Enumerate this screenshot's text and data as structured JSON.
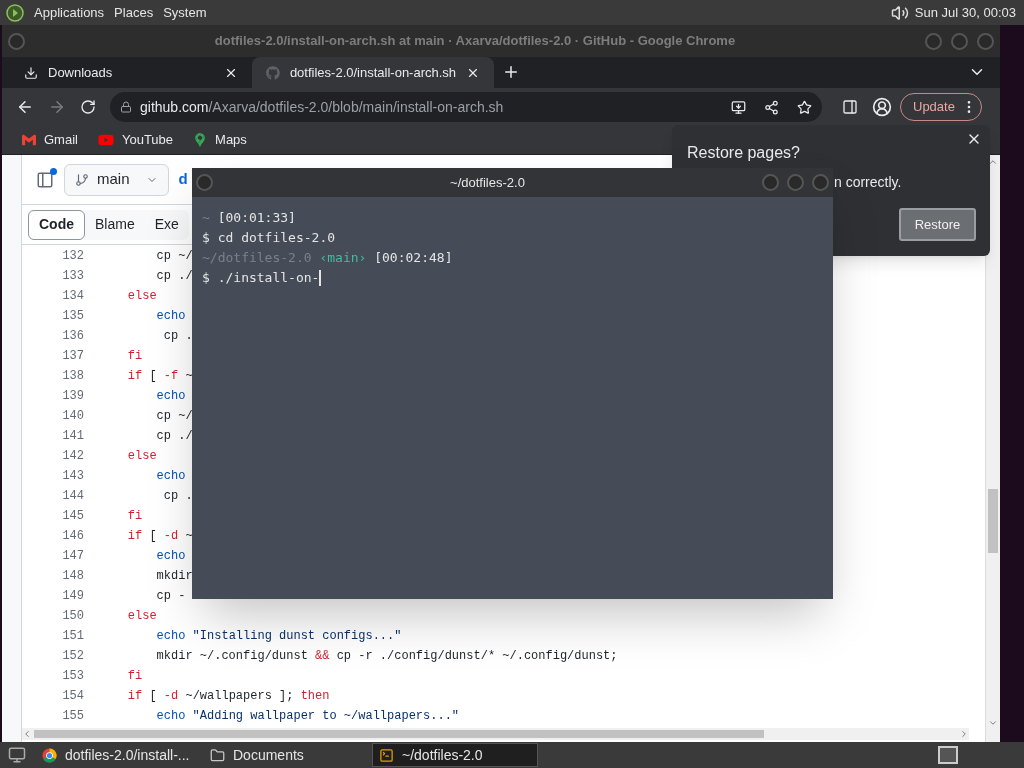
{
  "top_panel": {
    "menus": [
      "Applications",
      "Places",
      "System"
    ],
    "clock": "Sun Jul 30, 00:03"
  },
  "browser": {
    "title": "dotfiles-2.0/install-on-arch.sh at main · Axarva/dotfiles-2.0 · GitHub - Google Chrome",
    "tabs": [
      {
        "label": "Downloads",
        "kind": "download",
        "selected": false
      },
      {
        "label": "dotfiles-2.0/install-on-arch.sh",
        "kind": "github",
        "selected": true
      }
    ],
    "forward_disabled": true,
    "address": {
      "host": "github.com",
      "path": "/Axarva/dotfiles-2.0/blob/main/install-on-arch.sh"
    },
    "update_button": "Update",
    "bookmarks": [
      {
        "label": "Gmail",
        "kind": "gmail"
      },
      {
        "label": "YouTube",
        "kind": "youtube"
      },
      {
        "label": "Maps",
        "kind": "maps"
      }
    ]
  },
  "restore_popup": {
    "title": "Restore pages?",
    "message": "n correctly.",
    "button": "Restore"
  },
  "github": {
    "branch": "main",
    "repo_link": "d",
    "view_tabs": [
      {
        "label": "Code",
        "selected": true
      },
      {
        "label": "Blame",
        "selected": false
      },
      {
        "label": "Exe",
        "selected": false
      }
    ],
    "lines": [
      {
        "number": "132",
        "tokens": [
          {
            "kind": "plain",
            "text": "        cp ~/"
          }
        ]
      },
      {
        "number": "133",
        "tokens": [
          {
            "kind": "plain",
            "text": "        cp ./"
          }
        ]
      },
      {
        "number": "134",
        "tokens": [
          {
            "kind": "keyword",
            "text": "    else"
          }
        ]
      },
      {
        "number": "135",
        "tokens": [
          {
            "kind": "builtin",
            "text": "        echo"
          }
        ]
      },
      {
        "number": "136",
        "tokens": [
          {
            "kind": "plain",
            "text": "         cp ."
          }
        ]
      },
      {
        "number": "137",
        "tokens": [
          {
            "kind": "keyword",
            "text": "    fi"
          }
        ]
      },
      {
        "number": "138",
        "tokens": [
          {
            "kind": "keyword",
            "text": "    if"
          },
          {
            "kind": "plain",
            "text": " [ "
          },
          {
            "kind": "keyword",
            "text": "-f"
          },
          {
            "kind": "plain",
            "text": " ~"
          }
        ]
      },
      {
        "number": "139",
        "tokens": [
          {
            "kind": "builtin",
            "text": "        echo"
          }
        ]
      },
      {
        "number": "140",
        "tokens": [
          {
            "kind": "plain",
            "text": "        cp ~/"
          }
        ]
      },
      {
        "number": "141",
        "tokens": [
          {
            "kind": "plain",
            "text": "        cp ./"
          }
        ]
      },
      {
        "number": "142",
        "tokens": [
          {
            "kind": "keyword",
            "text": "    else"
          }
        ]
      },
      {
        "number": "143",
        "tokens": [
          {
            "kind": "builtin",
            "text": "        echo"
          }
        ]
      },
      {
        "number": "144",
        "tokens": [
          {
            "kind": "plain",
            "text": "         cp ."
          }
        ]
      },
      {
        "number": "145",
        "tokens": [
          {
            "kind": "keyword",
            "text": "    fi"
          }
        ]
      },
      {
        "number": "146",
        "tokens": [
          {
            "kind": "keyword",
            "text": "    if"
          },
          {
            "kind": "plain",
            "text": " [ "
          },
          {
            "kind": "keyword",
            "text": "-d"
          },
          {
            "kind": "plain",
            "text": " ~"
          }
        ]
      },
      {
        "number": "147",
        "tokens": [
          {
            "kind": "builtin",
            "text": "        echo"
          }
        ]
      },
      {
        "number": "148",
        "tokens": [
          {
            "kind": "plain",
            "text": "        mkdir"
          }
        ]
      },
      {
        "number": "149",
        "tokens": [
          {
            "kind": "plain",
            "text": "        cp -"
          }
        ]
      },
      {
        "number": "150",
        "tokens": [
          {
            "kind": "keyword",
            "text": "    else"
          }
        ]
      },
      {
        "number": "151",
        "tokens": [
          {
            "kind": "builtin",
            "text": "        echo"
          },
          {
            "kind": "string",
            "text": " \"Installing dunst configs...\""
          }
        ]
      },
      {
        "number": "152",
        "tokens": [
          {
            "kind": "plain",
            "text": "        mkdir ~/.config/dunst "
          },
          {
            "kind": "keyword",
            "text": "&&"
          },
          {
            "kind": "plain",
            "text": " cp -r ./config/dunst/* ~/.config/dunst;"
          }
        ]
      },
      {
        "number": "153",
        "tokens": [
          {
            "kind": "keyword",
            "text": "    fi"
          }
        ]
      },
      {
        "number": "154",
        "tokens": [
          {
            "kind": "keyword",
            "text": "    if"
          },
          {
            "kind": "plain",
            "text": " [ "
          },
          {
            "kind": "keyword",
            "text": "-d"
          },
          {
            "kind": "plain",
            "text": " ~/wallpapers ]; "
          },
          {
            "kind": "keyword",
            "text": "then"
          }
        ]
      },
      {
        "number": "155",
        "tokens": [
          {
            "kind": "builtin",
            "text": "        echo"
          },
          {
            "kind": "string",
            "text": " \"Adding wallpaper to ~/wallpapers...\""
          }
        ]
      }
    ]
  },
  "terminal": {
    "title": "~/dotfiles-2.0",
    "cursor": true,
    "lines": [
      [
        {
          "kind": "dim",
          "text": "~"
        },
        {
          "kind": "plain",
          "text": " [00:01:33]"
        }
      ],
      [
        {
          "kind": "plain",
          "text": "$ cd dotfiles-2.0"
        }
      ],
      [
        {
          "kind": "dim",
          "text": "~/dotfiles-2.0"
        },
        {
          "kind": "branch",
          "text": " ‹main›"
        },
        {
          "kind": "plain",
          "text": " [00:02:48]"
        }
      ],
      [
        {
          "kind": "plain",
          "text": "$ ./install-on-"
        }
      ]
    ]
  },
  "taskbar": {
    "items": [
      {
        "label": "dotfiles-2.0/install-...",
        "kind": "browser",
        "selected": false
      },
      {
        "label": "Documents",
        "kind": "folder",
        "selected": false
      },
      {
        "label": "~/dotfiles-2.0",
        "kind": "terminal",
        "selected": true
      }
    ]
  }
}
